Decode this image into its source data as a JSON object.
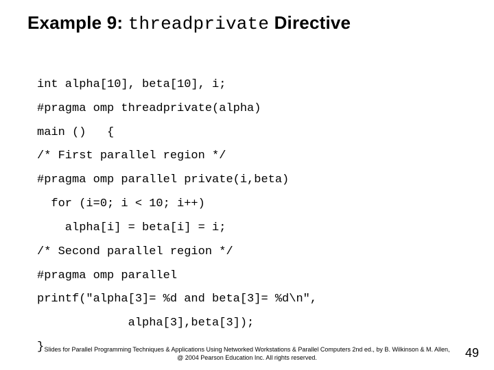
{
  "title": {
    "prefix": "Example 9: ",
    "mono": "threadprivate",
    "suffix": " Directive"
  },
  "code": {
    "l1": "int alpha[10], beta[10], i;",
    "l2": "#pragma omp threadprivate(alpha)",
    "l3": "main ()   {",
    "l4": "/* First parallel region */",
    "l5": "#pragma omp parallel private(i,beta)",
    "l6": "  for (i=0; i < 10; i++)",
    "l7": "    alpha[i] = beta[i] = i;",
    "l8": "/* Second parallel region */",
    "l9": "#pragma omp parallel",
    "l10": "printf(\"alpha[3]= %d and beta[3]= %d\\n\",",
    "l11": "             alpha[3],beta[3]);",
    "l12": "}"
  },
  "footer": {
    "line1": "Slides for Parallel Programming Techniques & Applications Using Networked Workstations & Parallel Computers 2nd ed., by B. Wilkinson & M. Allen,",
    "line2": "@ 2004 Pearson Education Inc. All rights reserved."
  },
  "page": "49"
}
